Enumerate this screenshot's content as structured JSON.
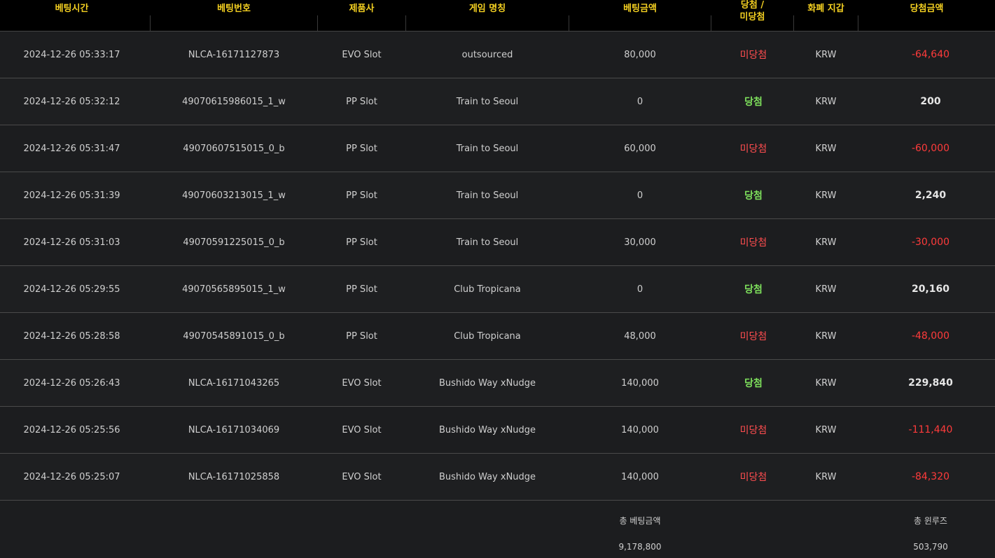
{
  "header": {
    "bet_time": "베팅시간",
    "bet_id": "베팅번호",
    "provider": "제품사",
    "game_name": "게임 명칭",
    "bet_amount": "베팅금액",
    "result_line1": "당첨 /",
    "result_line2": "미당첨",
    "currency": "화폐 지갑",
    "win_amount": "당첨금액"
  },
  "rows": [
    {
      "time": "2024-12-26 05:33:17",
      "id": "NLCA-16171127873",
      "provider": "EVO Slot",
      "game": "outsourced",
      "bet": "80,000",
      "result": "미당첨",
      "currency": "KRW",
      "amount": "-64,640",
      "win": false
    },
    {
      "time": "2024-12-26 05:32:12",
      "id": "49070615986015_1_w",
      "provider": "PP Slot",
      "game": "Train to Seoul",
      "bet": "0",
      "result": "당첨",
      "currency": "KRW",
      "amount": "200",
      "win": true
    },
    {
      "time": "2024-12-26 05:31:47",
      "id": "49070607515015_0_b",
      "provider": "PP Slot",
      "game": "Train to Seoul",
      "bet": "60,000",
      "result": "미당첨",
      "currency": "KRW",
      "amount": "-60,000",
      "win": false
    },
    {
      "time": "2024-12-26 05:31:39",
      "id": "49070603213015_1_w",
      "provider": "PP Slot",
      "game": "Train to Seoul",
      "bet": "0",
      "result": "당첨",
      "currency": "KRW",
      "amount": "2,240",
      "win": true
    },
    {
      "time": "2024-12-26 05:31:03",
      "id": "49070591225015_0_b",
      "provider": "PP Slot",
      "game": "Train to Seoul",
      "bet": "30,000",
      "result": "미당첨",
      "currency": "KRW",
      "amount": "-30,000",
      "win": false
    },
    {
      "time": "2024-12-26 05:29:55",
      "id": "49070565895015_1_w",
      "provider": "PP Slot",
      "game": "Club Tropicana",
      "bet": "0",
      "result": "당첨",
      "currency": "KRW",
      "amount": "20,160",
      "win": true
    },
    {
      "time": "2024-12-26 05:28:58",
      "id": "49070545891015_0_b",
      "provider": "PP Slot",
      "game": "Club Tropicana",
      "bet": "48,000",
      "result": "미당첨",
      "currency": "KRW",
      "amount": "-48,000",
      "win": false
    },
    {
      "time": "2024-12-26 05:26:43",
      "id": "NLCA-16171043265",
      "provider": "EVO Slot",
      "game": "Bushido Way xNudge",
      "bet": "140,000",
      "result": "당첨",
      "currency": "KRW",
      "amount": "229,840",
      "win": true
    },
    {
      "time": "2024-12-26 05:25:56",
      "id": "NLCA-16171034069",
      "provider": "EVO Slot",
      "game": "Bushido Way xNudge",
      "bet": "140,000",
      "result": "미당첨",
      "currency": "KRW",
      "amount": "-111,440",
      "win": false
    },
    {
      "time": "2024-12-26 05:25:07",
      "id": "NLCA-16171025858",
      "provider": "EVO Slot",
      "game": "Bushido Way xNudge",
      "bet": "140,000",
      "result": "미당첨",
      "currency": "KRW",
      "amount": "-84,320",
      "win": false
    }
  ],
  "footer": {
    "total_bet_label": "총 베팅금액",
    "total_bet_value": "9,178,800",
    "total_winloss_label": "총 윈루즈",
    "total_winloss_value": "503,790"
  },
  "colors": {
    "header_text": "#f4d021",
    "win": "#7ee05c",
    "lose": "#ff4d4f",
    "negative_amount": "#ff3b3b"
  }
}
